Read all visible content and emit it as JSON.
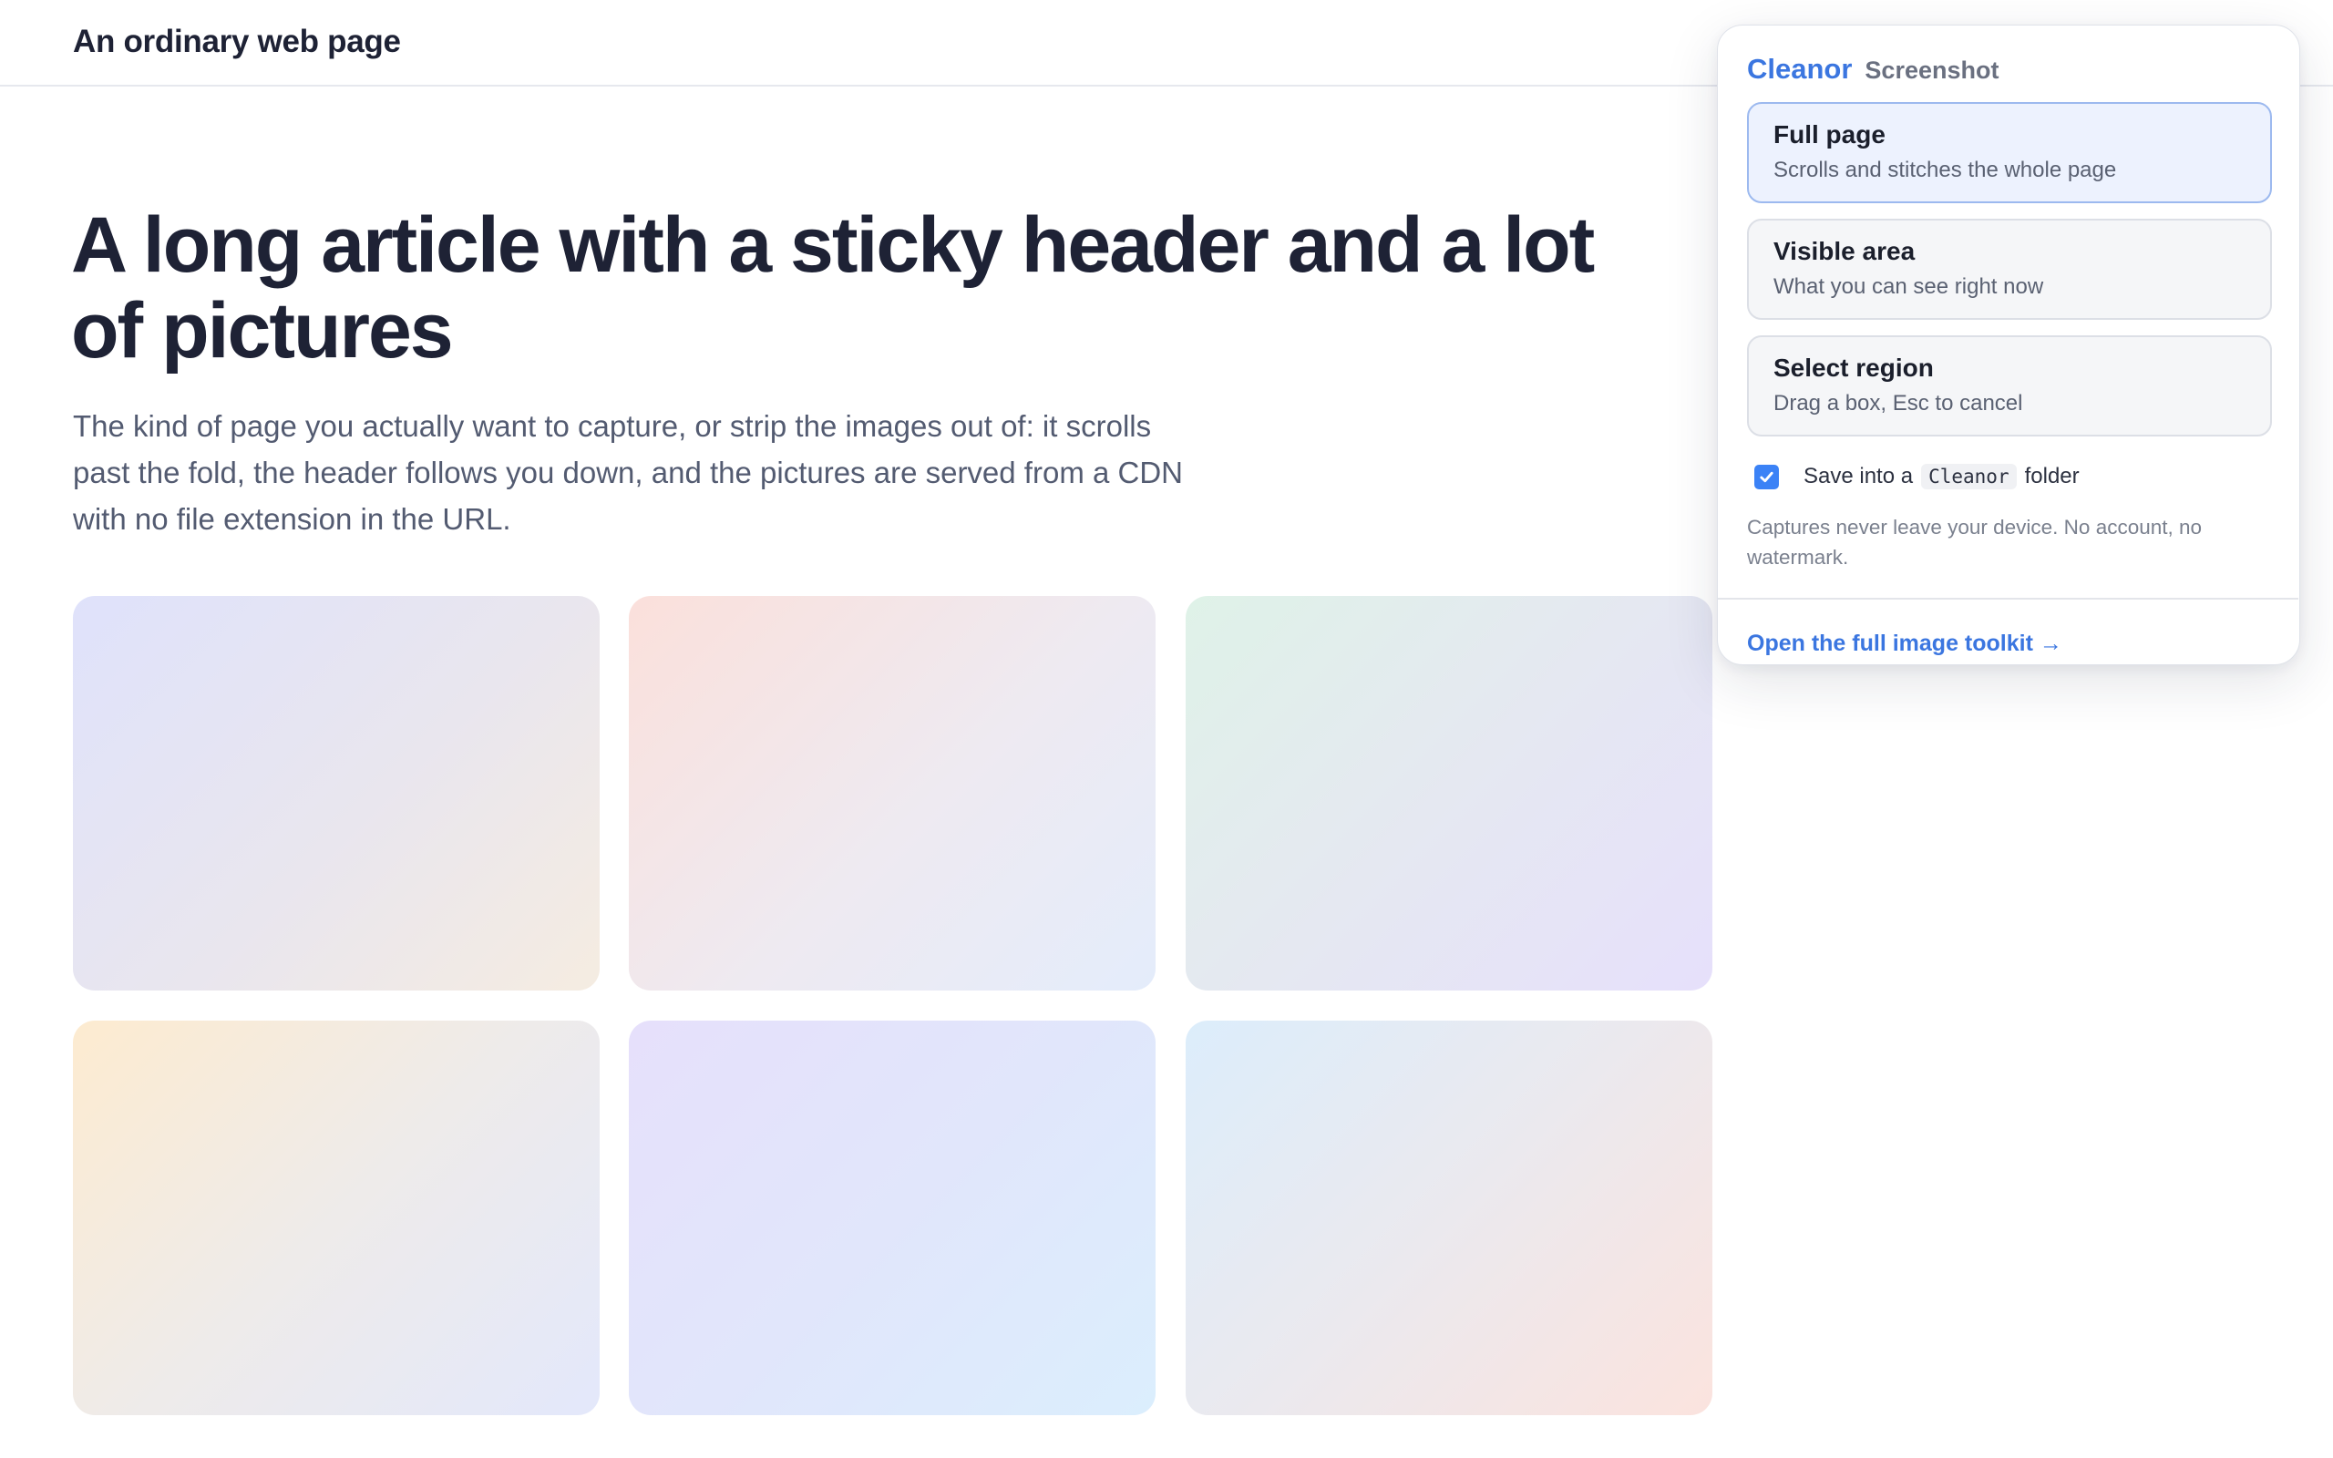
{
  "site": {
    "title": "An ordinary web page"
  },
  "article": {
    "heading": "A long article with a sticky header and a lot of pictures",
    "lede": "The kind of page you actually want to capture, or strip the images out of: it scrolls past the fold, the header follows you down, and the pictures are served from a CDN with no file extension in the URL."
  },
  "popup": {
    "brand": "Cleanor",
    "subtitle": "Screenshot",
    "options": [
      {
        "title": "Full page",
        "description": "Scrolls and stitches the whole page",
        "selected": true
      },
      {
        "title": "Visible area",
        "description": "What you can see right now",
        "selected": false
      },
      {
        "title": "Select region",
        "description": "Drag a box, Esc to cancel",
        "selected": false
      }
    ],
    "save": {
      "checked": true,
      "prefix": "Save into a",
      "folder": "Cleanor",
      "suffix": "folder"
    },
    "note": "Captures never leave your device. No account, no watermark.",
    "toolkit_link": "Open the full image toolkit →"
  },
  "colors": {
    "accent": "#3b76e0",
    "checkbox": "#3b82f6",
    "selected_bg": "#edf2fe"
  },
  "icons": {
    "checkbox": "checkmark-icon"
  }
}
